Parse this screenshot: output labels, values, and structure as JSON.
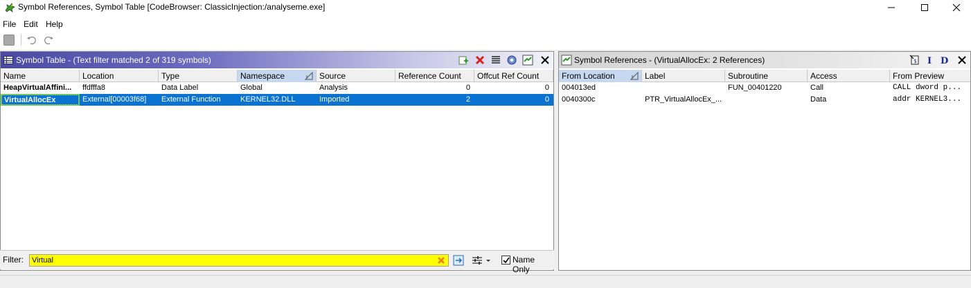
{
  "window": {
    "title": "Symbol References, Symbol Table [CodeBrowser: ClassicInjection:/analyseme.exe]"
  },
  "menu": {
    "items": [
      "File",
      "Edit",
      "Help"
    ]
  },
  "symbol_table": {
    "title": "Symbol Table -  (Text filter matched 2 of 319 symbols)",
    "columns": [
      "Name",
      "Location",
      "Type",
      "Namespace",
      "Source",
      "Reference Count",
      "Offcut Ref Count"
    ],
    "rows": [
      [
        "HeapVirtualAffini...",
        "ffdfffa8",
        "Data Label",
        "Global",
        "Analysis",
        "0",
        "0"
      ],
      [
        "VirtualAllocEx",
        "External[00003f68]",
        "External Function",
        "KERNEL32.DLL",
        "Imported",
        "2",
        "0"
      ]
    ],
    "selected_row": 1
  },
  "filter": {
    "label": "Filter:",
    "value": "Virtual",
    "name_only_label": "Name Only",
    "name_only_checked": true
  },
  "symbol_references": {
    "title": "Symbol References - (VirtualAllocEx: 2 References)",
    "columns": [
      "From Location",
      "Label",
      "Subroutine",
      "Access",
      "From Preview"
    ],
    "rows": [
      [
        "004013ed",
        "",
        "FUN_00401220",
        "Call",
        "CALL dword p..."
      ],
      [
        "0040300c",
        "PTR_VirtualAllocEx_...",
        "",
        "Data",
        "addr KERNEL3..."
      ]
    ]
  },
  "colors": {
    "selection": "#0a72d0",
    "filter_bg": "#ffff00",
    "header_gradient_start": "#4a4aa4"
  },
  "icons": [
    "ghidra-dragon-icon",
    "minimize-icon",
    "maximize-icon",
    "close-icon",
    "save-icon",
    "undo-icon",
    "redo-icon",
    "table-icon",
    "create-icon",
    "delete-icon",
    "list-icon",
    "settings-icon",
    "refs-icon",
    "close-panel-icon",
    "clear-filter-icon",
    "filter-options-icon",
    "sliders-icon"
  ]
}
